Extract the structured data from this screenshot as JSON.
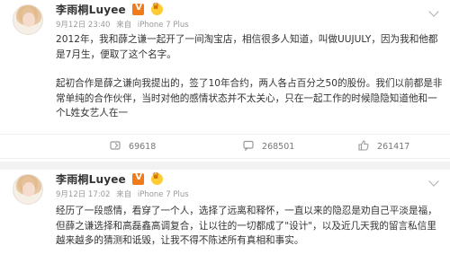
{
  "posts": [
    {
      "username": "李雨桐Luyee",
      "time": "9月12日 23:40",
      "source_prefix": "来自",
      "device": "iPhone 7 Plus",
      "paragraphs": [
        "2012年，我和薛之谦一起开了一间淘宝店，相信很多人知道，叫做UUJULY，因为我和他都是7月生，便取了这个名字。",
        "起初合作是薛之谦向我提出的，签了10年合约，两人各占百分之50的股份。我们以前都是非常单纯的合作伙伴，当时对他的感情状态并不太关心，只在一起工作的时候隐隐知道他和一个L姓女艺人在一"
      ],
      "stats": {
        "reposts": "69618",
        "comments": "268501",
        "likes": "261417"
      }
    },
    {
      "username": "李雨桐Luyee",
      "time": "9月12日 17:02",
      "source_prefix": "来自",
      "device": "iPhone 7 Plus",
      "paragraphs": [
        "经历了一段感情，看穿了一个人，选择了远离和释怀，一直以来的隐忍是劝自己平淡是福，但薛之谦选择和高磊鑫高调复合，让以往的一切都成了\"设计\"，以及近几天我的留言私信里越来越多的猜测和诋毁，让我不得不陈述所有真相和事实。"
      ]
    }
  ],
  "colors": {
    "repost": "#999999",
    "comment": "#999999",
    "like": "#999999",
    "vip_badge": "#f07b1a"
  }
}
